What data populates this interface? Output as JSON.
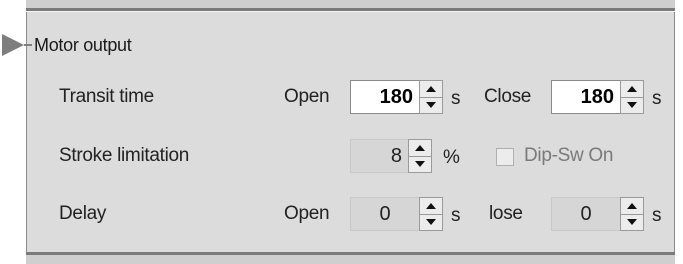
{
  "section": {
    "title": "Motor output"
  },
  "rows": {
    "transit_time": {
      "label": "Transit time",
      "open_label": "Open",
      "open_value": "180",
      "open_unit": "s",
      "close_label": "Close",
      "close_value": "180",
      "close_unit": "s"
    },
    "stroke_limitation": {
      "label": "Stroke limitation",
      "value": "8",
      "unit": "%",
      "checkbox_label": "Dip-Sw On",
      "checkbox_checked": false
    },
    "delay": {
      "label": "Delay",
      "open_label": "Open",
      "open_value": "0",
      "open_unit": "s",
      "close_label": "lose",
      "close_value": "0",
      "close_unit": "s"
    }
  },
  "icons": {
    "section_arrow": "triangle-right-icon",
    "spin_up": "triangle-up-icon",
    "spin_down": "triangle-down-icon"
  },
  "colors": {
    "panel_bg": "#dcdcdc",
    "border_dark": "#7a7a7a",
    "disabled_text": "#7a7a7a"
  }
}
